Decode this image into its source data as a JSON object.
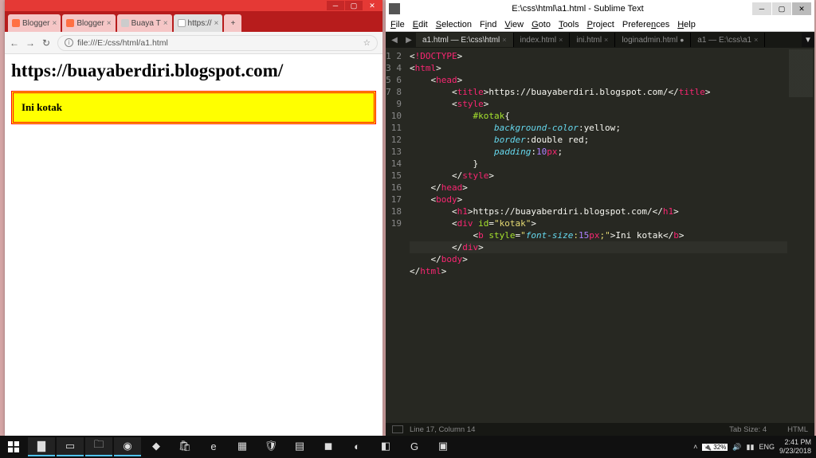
{
  "chrome": {
    "tabs": [
      {
        "label": "Blogger"
      },
      {
        "label": "Blogger"
      },
      {
        "label": "Buaya T"
      },
      {
        "label": "https://"
      }
    ],
    "nav": {
      "back_icon": "←",
      "fwd_icon": "→",
      "reload_icon": "↻"
    },
    "omnibox": "file:///E:/css/html/a1.html",
    "page": {
      "h1": "https://buayaberdiri.blogspot.com/",
      "kotak_text": "Ini kotak"
    }
  },
  "sublime": {
    "title": "E:\\css\\html\\a1.html - Sublime Text",
    "menu": [
      "File",
      "Edit",
      "Selection",
      "Find",
      "View",
      "Goto",
      "Tools",
      "Project",
      "Preferences",
      "Help"
    ],
    "tabs": [
      {
        "label": "a1.html — E:\\css\\html",
        "active": true
      },
      {
        "label": "index.html"
      },
      {
        "label": "ini.html"
      },
      {
        "label": "loginadmin.html",
        "dirty": true
      },
      {
        "label": "a1 — E:\\css\\a1"
      }
    ],
    "status_left": "Line 17, Column 14",
    "status_tab": "Tab Size: 4",
    "status_lang": "HTML",
    "code": {
      "line1": {
        "doctype": "!DOCTYPE"
      },
      "line2": {
        "tag": "html"
      },
      "line3": {
        "tag": "head"
      },
      "line4": {
        "tag": "title",
        "text": "https://buayaberdiri.blogspot.com/"
      },
      "line5": {
        "tag": "style"
      },
      "line6": {
        "sel": "#kotak",
        "brace": "{"
      },
      "line7": {
        "prop": "background-color",
        "val": "yellow",
        "semi": ";"
      },
      "line8": {
        "prop": "border",
        "val": "double red",
        "semi": ";"
      },
      "line9": {
        "prop": "padding",
        "num": "10",
        "unit": "px",
        "semi": ";"
      },
      "line10": {
        "brace": "}"
      },
      "line11": {
        "tag": "style"
      },
      "line12": {
        "tag": "head"
      },
      "line13": {
        "tag": "body"
      },
      "line14": {
        "tag": "h1",
        "text": "https://buayaberdiri.blogspot.com/"
      },
      "line15": {
        "tag": "div",
        "attr": "id",
        "val": "kotak"
      },
      "line16": {
        "tag": "b",
        "attr": "style",
        "prop": "font-size",
        "num": "15",
        "unit": "px",
        "semi": ";",
        "text": "Ini kotak"
      },
      "line17": {
        "tag": "div"
      },
      "line18": {
        "tag": "body"
      },
      "line19": {
        "tag": "html"
      }
    }
  },
  "taskbar": {
    "lang": "ENG",
    "time": "2:41 PM",
    "date": "9/23/2018",
    "battery": "32%"
  }
}
